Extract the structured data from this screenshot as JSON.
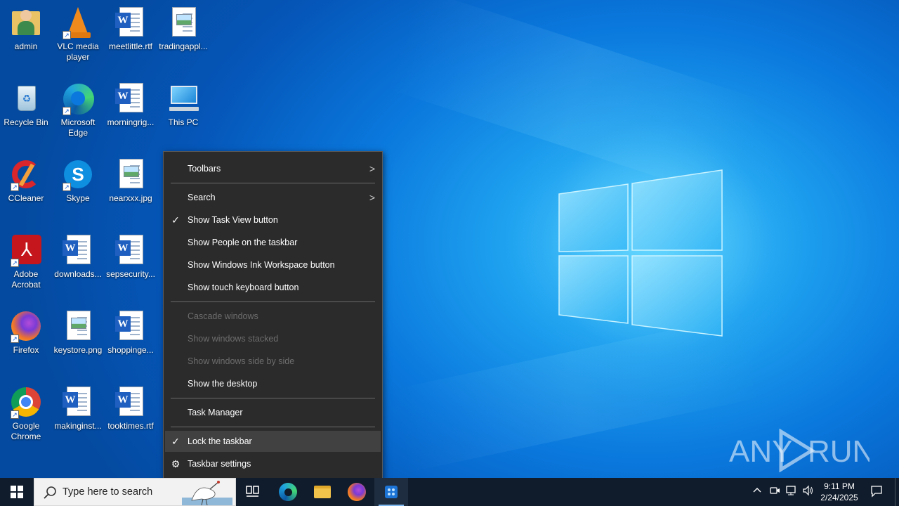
{
  "desktop_icons": [
    {
      "label": "admin",
      "icon": "user-folder-icon"
    },
    {
      "label": "VLC media player",
      "icon": "vlc-icon"
    },
    {
      "label": "meetlittle.rtf",
      "icon": "word-document-icon"
    },
    {
      "label": "tradingappl...",
      "icon": "image-file-icon"
    },
    {
      "label": "Recycle Bin",
      "icon": "recycle-bin-icon"
    },
    {
      "label": "Microsoft Edge",
      "icon": "edge-icon"
    },
    {
      "label": "morningrig...",
      "icon": "word-document-icon"
    },
    {
      "label": "This PC",
      "icon": "this-pc-icon"
    },
    {
      "label": "CCleaner",
      "icon": "ccleaner-icon"
    },
    {
      "label": "Skype",
      "icon": "skype-icon"
    },
    {
      "label": "nearxxx.jpg",
      "icon": "image-file-icon"
    },
    {
      "label": "Adobe Acrobat",
      "icon": "acrobat-icon"
    },
    {
      "label": "downloads...",
      "icon": "word-document-icon"
    },
    {
      "label": "sepsecurity...",
      "icon": "word-document-icon"
    },
    {
      "label": "Firefox",
      "icon": "firefox-icon"
    },
    {
      "label": "keystore.png",
      "icon": "image-file-icon"
    },
    {
      "label": "shoppinge...",
      "icon": "word-document-icon"
    },
    {
      "label": "Google Chrome",
      "icon": "chrome-icon"
    },
    {
      "label": "makinginst...",
      "icon": "word-document-icon"
    },
    {
      "label": "tooktimes.rtf",
      "icon": "word-document-icon"
    }
  ],
  "context_menu": {
    "toolbars": "Toolbars",
    "search": "Search",
    "show_task_view": "Show Task View button",
    "show_people": "Show People on the taskbar",
    "show_ink": "Show Windows Ink Workspace button",
    "show_touch_keyboard": "Show touch keyboard button",
    "cascade": "Cascade windows",
    "stacked": "Show windows stacked",
    "side_by_side": "Show windows side by side",
    "show_desktop": "Show the desktop",
    "task_manager": "Task Manager",
    "lock_taskbar": "Lock the taskbar",
    "taskbar_settings": "Taskbar settings",
    "check_glyph": "✓",
    "arrow_glyph": ">",
    "settings_glyph": "⚙"
  },
  "taskbar": {
    "search_placeholder": "Type here to search",
    "time": "9:11 PM",
    "date": "2/24/2025",
    "pinned": [
      "task-view-icon",
      "edge-icon",
      "file-explorer-icon",
      "firefox-icon",
      "any-run-icon"
    ]
  },
  "watermark": {
    "text_left": "ANY",
    "text_right": "RUN"
  },
  "colors": {
    "menu_bg": "#2b2b2b",
    "menu_highlight": "#414141",
    "taskbar_bg": "#101c2c",
    "desktop_blue": "#0a78dd"
  }
}
